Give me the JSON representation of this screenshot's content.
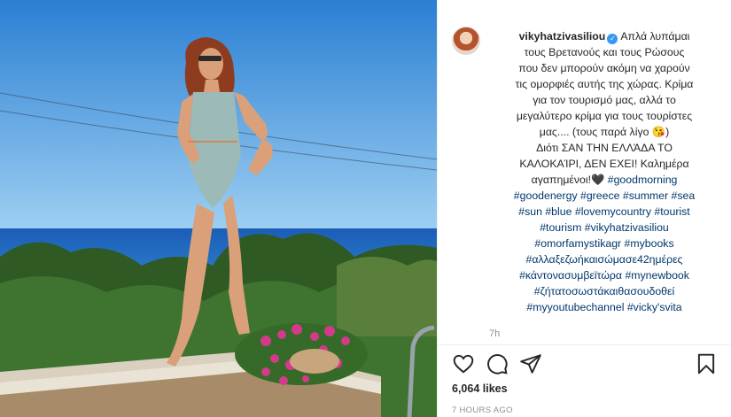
{
  "post": {
    "username": "vikyhatzivasiliou",
    "verified_icon": "verified-badge-icon",
    "caption": {
      "first_line": "Απλά λυπάμαι",
      "lines": [
        "τους Βρετανούς και τους Ρώσους",
        "που δεν μπορούν ακόμη να χαρούν",
        "τις ομορφιές αυτής της χώρας. Κρίμα",
        "για τον τουρισμό μας, αλλά το",
        "μεγαλύτερο κρίμα για τους τουρίστες",
        "μας.... (τους παρά λίγο 😘)",
        "Διότι ΣΑΝ ΤΗΝ ΕΛΛΆΔΑ ΤΟ",
        "ΚΑΛΟΚΑΊΡΙ, ΔΕΝ ΕΧΕΙ! Καλημέρα"
      ],
      "last_text": "αγαπημένοι!🖤 ",
      "last_tag": "#goodmorning",
      "hashtag_lines": [
        "#goodenergy #greece #summer #sea",
        "#sun #blue #lovemycountry #tourist",
        "#tourism #vikyhatzivasiliou",
        "#omorfamystikagr #mybooks",
        "#αλλαξεζωήκαισώμασε42ημέρες",
        "#κάντονασυμβεϊτώρα #mynewbook",
        "#ζήτατοσωστάκαιθασουδοθεί",
        "#myyoutubechannel #vicky'svita"
      ]
    },
    "time_short": "7h",
    "likes": "6,064 likes",
    "time_ago": "7 HOURS AGO"
  },
  "actions": {
    "like_icon": "heart-icon",
    "comment_icon": "comment-icon",
    "share_icon": "share-icon",
    "save_icon": "bookmark-icon"
  },
  "colors": {
    "link": "#00376b",
    "muted": "#8e8e8e",
    "verified": "#3897f0",
    "sky": "#3d8fd9",
    "sea": "#1d5fb5"
  }
}
